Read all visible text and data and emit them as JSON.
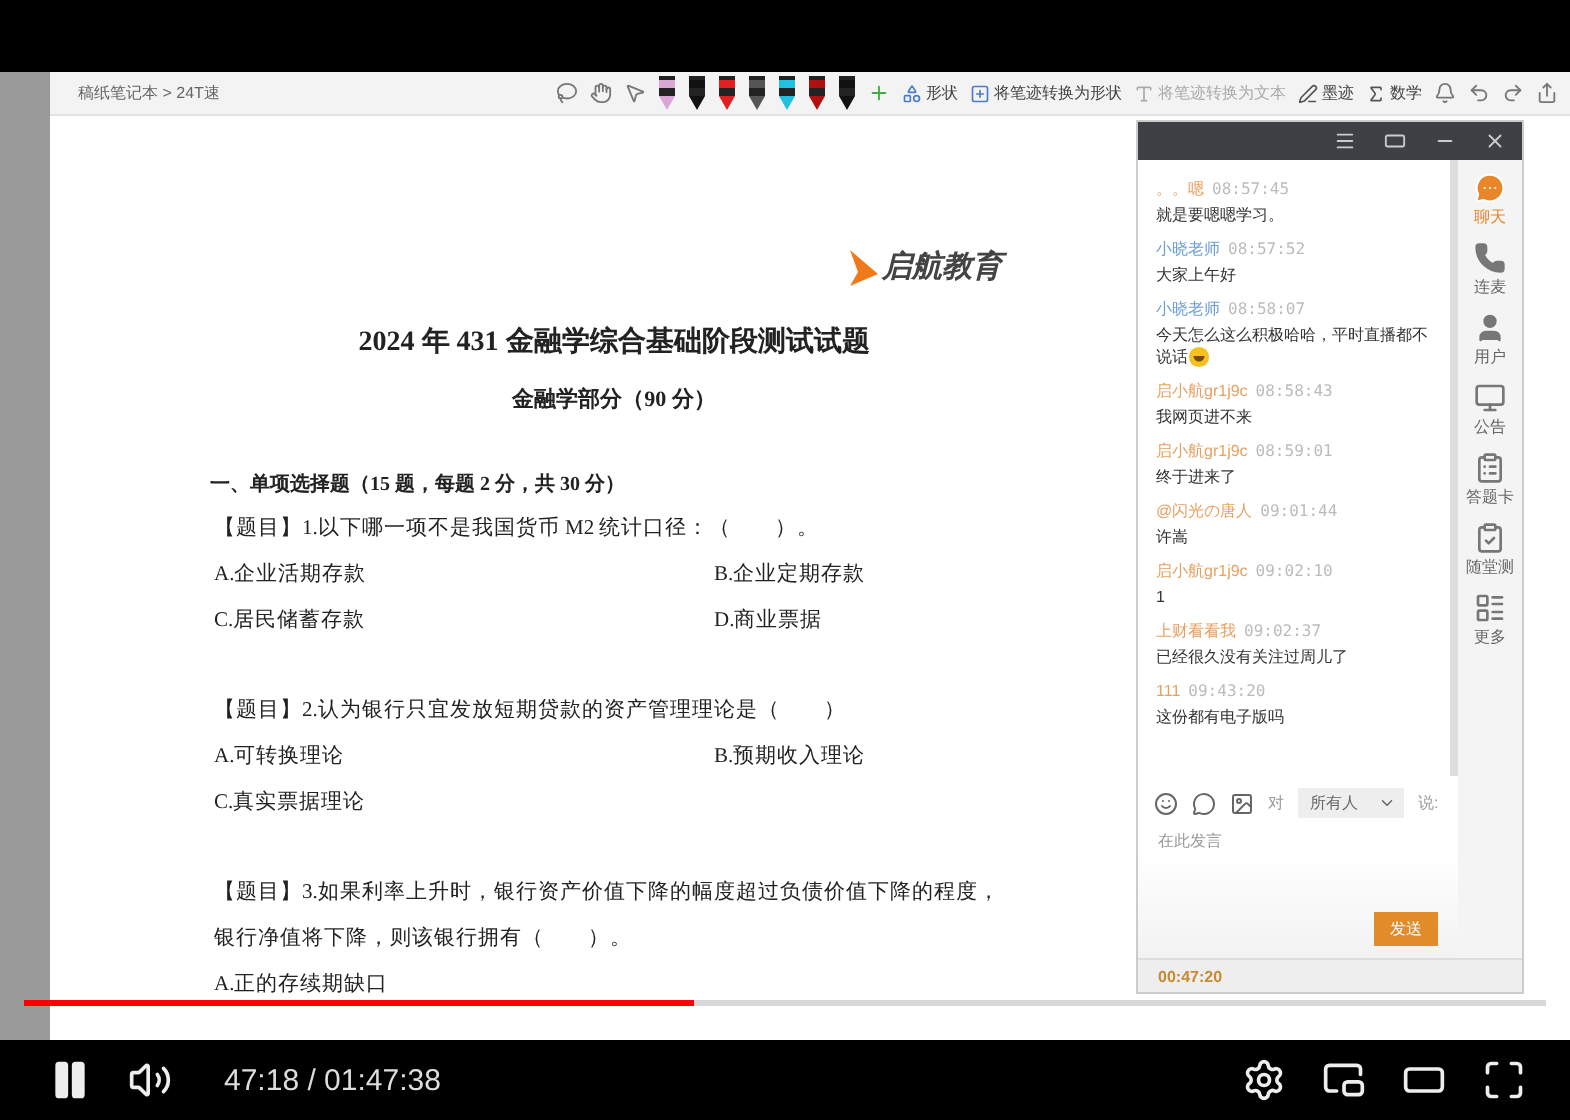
{
  "toolbar": {
    "breadcrumb": "稿纸笔记本 > 24T速",
    "pens": [
      {
        "color": "#d9a6d6"
      },
      {
        "color": "#111111"
      },
      {
        "color": "#e02020"
      },
      {
        "color": "#555555"
      },
      {
        "color": "#20c0e0"
      },
      {
        "color": "#b01010"
      },
      {
        "color": "#111111"
      }
    ],
    "actions": [
      {
        "kind": "shape",
        "label": "形状",
        "disabled": false
      },
      {
        "kind": "convert",
        "label": "将笔迹转换为形状",
        "disabled": false
      },
      {
        "kind": "text",
        "label": "将笔迹转换为文本",
        "disabled": true
      },
      {
        "kind": "ink",
        "label": "墨迹",
        "disabled": false
      },
      {
        "kind": "math",
        "label": "数学",
        "disabled": false
      }
    ]
  },
  "document": {
    "logo": "启航教育",
    "title": "2024 年 431 金融学综合基础阶段测试试题",
    "subtitle": "金融学部分（90 分）",
    "section": "一、单项选择题（15 题，每题 2 分，共 30 分）",
    "questions": [
      {
        "stem": "【题目】1.以下哪一项不是我国货币 M2 统计口径：（　　）。",
        "options": [
          "A.企业活期存款",
          "B.企业定期存款",
          "C.居民储蓄存款",
          "D.商业票据"
        ]
      },
      {
        "stem": "【题目】2.认为银行只宜发放短期贷款的资产管理理论是（　　）",
        "options": [
          "A.可转换理论",
          "B.预期收入理论",
          "C.真实票据理论"
        ]
      },
      {
        "stem": "【题目】3.如果利率上升时，银行资产价值下降的幅度超过负债价值下降的程度，银行净值将下降，则该银行拥有（　　）。",
        "options": [
          "A.正的存续期缺口"
        ]
      }
    ]
  },
  "chat": {
    "messages": [
      {
        "name": "。。嗯",
        "color": "#e8a060",
        "time": "08:57:45",
        "text": "就是要嗯嗯学习。",
        "emoji": false
      },
      {
        "name": "小晓老师",
        "color": "#6a9fd8",
        "time": "08:57:52",
        "text": "大家上午好",
        "emoji": false
      },
      {
        "name": "小晓老师",
        "color": "#6a9fd8",
        "time": "08:58:07",
        "text": "今天怎么这么积极哈哈，平时直播都不说话",
        "emoji": true
      },
      {
        "name": "启小航gr1j9c",
        "color": "#e8a060",
        "time": "08:58:43",
        "text": "我网页进不来",
        "emoji": false
      },
      {
        "name": "启小航gr1j9c",
        "color": "#e8a060",
        "time": "08:59:01",
        "text": "终于进来了",
        "emoji": false
      },
      {
        "name": "@闪光の唐人",
        "color": "#e8a060",
        "time": "09:01:44",
        "text": "许嵩",
        "emoji": false
      },
      {
        "name": "启小航gr1j9c",
        "color": "#e8a060",
        "time": "09:02:10",
        "text": "1",
        "emoji": false
      },
      {
        "name": "上财看看我",
        "color": "#e8a060",
        "time": "09:02:37",
        "text": "已经很久没有关注过周儿了",
        "emoji": false
      },
      {
        "name": "111",
        "color": "#e8a060",
        "time": "09:43:20",
        "text": "这份都有电子版吗",
        "emoji": false
      }
    ],
    "to_label": "对",
    "recipient": "所有人",
    "say_label": "说:",
    "placeholder": "在此发言",
    "send": "发送",
    "timer": "00:47:20",
    "sidebar": [
      {
        "kind": "chat",
        "label": "聊天",
        "selected": true
      },
      {
        "kind": "phone",
        "label": "连麦",
        "selected": false
      },
      {
        "kind": "user",
        "label": "用户",
        "selected": false
      },
      {
        "kind": "notice",
        "label": "公告",
        "selected": false
      },
      {
        "kind": "card",
        "label": "答题卡",
        "selected": false
      },
      {
        "kind": "quiz",
        "label": "随堂测",
        "selected": false
      },
      {
        "kind": "more",
        "label": "更多",
        "selected": false
      }
    ]
  },
  "player": {
    "playing": true,
    "level": 0.44,
    "time": "47:18 / 01:47:38"
  }
}
